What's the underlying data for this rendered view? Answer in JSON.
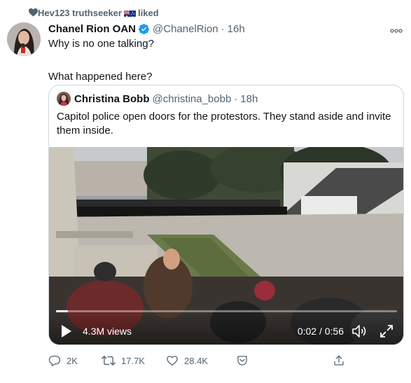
{
  "social_context": {
    "icon": "heart-icon",
    "text": "Hev123 truthseeker",
    "flag": "australia-flag-icon",
    "action": "liked"
  },
  "tweet": {
    "author_name": "Chanel Rion OAN",
    "verified": true,
    "handle": "@ChanelRion",
    "separator": "·",
    "time": "16h",
    "lines": [
      "Why is no one talking?",
      "",
      "What happened here?"
    ]
  },
  "quoted_tweet": {
    "author_name": "Christina Bobb",
    "handle": "@christina_bobb",
    "separator": "·",
    "time": "18h",
    "text": "Capitol police open doors for the protestors.  They stand aside and invite them inside."
  },
  "video": {
    "views": "4.3M views",
    "time": "0:02 / 0:56",
    "progress": 0.035
  },
  "actions": {
    "reply_count": "2K",
    "retweet_count": "17.7K",
    "like_count": "28.4K"
  },
  "colors": {
    "text": "#0f1419",
    "muted": "#536471",
    "verified": "#1d9bf0",
    "border": "#cfd9de"
  }
}
